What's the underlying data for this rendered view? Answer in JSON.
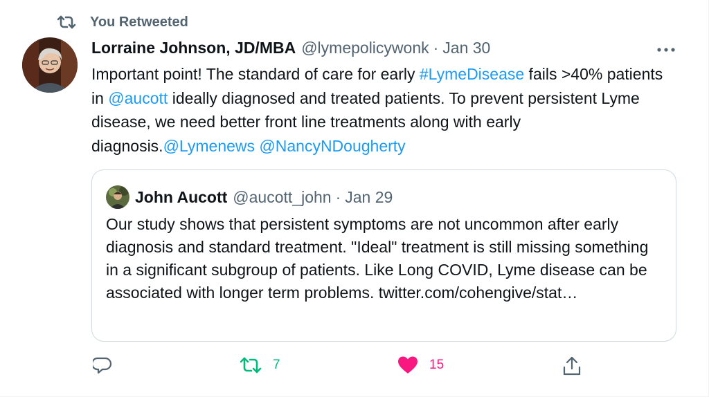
{
  "retweet_banner": {
    "label": "You Retweeted",
    "icon": "retweet-icon"
  },
  "tweet": {
    "author_name": "Lorraine Johnson, JD/MBA",
    "author_handle": "@lymepolicywonk",
    "separator": "·",
    "date": "Jan 30",
    "more_icon": "more-options-icon",
    "text_segments": [
      {
        "text": "Important point! The standard of care for early ",
        "type": "text"
      },
      {
        "text": "#LymeDisease",
        "type": "hashtag"
      },
      {
        "text": " fails >40% patients in ",
        "type": "text"
      },
      {
        "text": "@aucott",
        "type": "mention"
      },
      {
        "text": " ideally diagnosed and treated patients. To prevent persistent Lyme disease, we need better front line treatments along with early diagnosis.",
        "type": "text"
      },
      {
        "text": "@Lymenews",
        "type": "mention"
      },
      {
        "text": " ",
        "type": "text"
      },
      {
        "text": "@NancyNDougherty",
        "type": "mention"
      }
    ]
  },
  "quote": {
    "author_name": "John Aucott",
    "author_handle": "@aucott_john",
    "separator": "·",
    "date": "Jan 29",
    "text": "Our study shows that persistent symptoms are not uncommon after early diagnosis and standard treatment. \"Ideal\" treatment is still missing something in a significant subgroup of patients. Like Long COVID, Lyme disease can be associated with longer term problems.",
    "link": "twitter.com/cohengive/stat…"
  },
  "actions": {
    "reply": {
      "icon": "reply-icon",
      "count": ""
    },
    "retweet": {
      "icon": "retweet-icon",
      "count": "7",
      "active": true,
      "color": "#00ba7c"
    },
    "like": {
      "icon": "heart-icon",
      "count": "15",
      "active": true,
      "color": "#f91880"
    },
    "share": {
      "icon": "share-icon",
      "count": ""
    }
  },
  "colors": {
    "link": "#1d9bf0",
    "secondary_text": "#536471",
    "primary_text": "#0f1419",
    "border": "#cfd9de"
  }
}
